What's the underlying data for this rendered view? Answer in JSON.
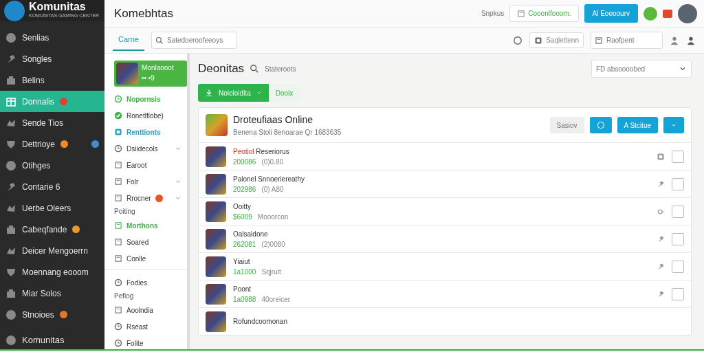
{
  "brand": {
    "name": "Komunitas",
    "tagline": "KOMUNITAS GAMING CENTER"
  },
  "sidebar": {
    "items": [
      {
        "label": "Senlias",
        "selected": false
      },
      {
        "label": "Songles",
        "selected": false
      },
      {
        "label": "Belins",
        "selected": false
      },
      {
        "label": "Donnalis",
        "selected": true,
        "color": "#e0412f"
      },
      {
        "label": "Sende Tios",
        "selected": false
      },
      {
        "label": "Dettrioye",
        "selected": false,
        "color": "#f08a24"
      },
      {
        "label": "Otihges",
        "selected": false
      },
      {
        "label": "Contarie 6",
        "selected": false
      },
      {
        "label": "Uerbe Oleers",
        "selected": false
      },
      {
        "label": "Cabeqfande",
        "selected": false,
        "color": "#f0962a"
      },
      {
        "label": "Deicer Mengoerrn",
        "selected": false
      },
      {
        "label": "Moennang eooom",
        "selected": false
      },
      {
        "label": "Miar Solos",
        "selected": false
      },
      {
        "label": "Stnoioes",
        "selected": false,
        "color": "#e8732a"
      }
    ],
    "footer": "Komunitas"
  },
  "header": {
    "title": "Komebhtas",
    "link": "Snpkus",
    "outline_button": "Cooonlfooom.",
    "primary_button": "Al Eoooourv"
  },
  "subbar": {
    "tab": "Carne",
    "search_placeholder": "Satedoeroofeeoys",
    "button": "Saqlettenn",
    "field_placeholder": "Raofpent"
  },
  "panel": {
    "featured": {
      "title": "Monlaooot",
      "meta": "•• •9"
    },
    "items": [
      {
        "kind": "item",
        "label": "Nopornsis",
        "color": "#3cb043"
      },
      {
        "kind": "item",
        "label": "Ronetlfiobe)"
      },
      {
        "kind": "item",
        "label": "Renttionts",
        "color": "#1ea0c8"
      },
      {
        "kind": "item",
        "label": "Dsiidecols",
        "expanded": false
      },
      {
        "kind": "item",
        "label": "Earoot"
      },
      {
        "kind": "item",
        "label": "Folr",
        "expanded": false
      },
      {
        "kind": "item",
        "label": "Rrocner",
        "expanded": false,
        "alert": true
      },
      {
        "kind": "header",
        "label": "Poiting"
      },
      {
        "kind": "item",
        "label": "Morthons",
        "color": "#3cb043"
      },
      {
        "kind": "item",
        "label": "Soared"
      },
      {
        "kind": "item",
        "label": "Conlle"
      },
      {
        "kind": "divider"
      },
      {
        "kind": "item",
        "label": "Fodies"
      },
      {
        "kind": "header",
        "label": "Pefiog"
      },
      {
        "kind": "item",
        "label": "Aoolndia"
      },
      {
        "kind": "item",
        "label": "Rseast"
      },
      {
        "kind": "item",
        "label": "Folite"
      }
    ]
  },
  "main": {
    "title": "Deonitas",
    "subtitle": "Stateroots",
    "select": "FD absoooobed",
    "primary_button": "Noioloidita",
    "secondary_button": "Dooix",
    "card": {
      "title": "Droteufiaas Online",
      "subtitle": "Benena Stoli 8enoarae Qr 1683635",
      "filter_button": "Sasiov",
      "action_button": "A Stcitue"
    },
    "rows": [
      {
        "tag": "Peotiol",
        "title": "Reseriorus",
        "score": "200086",
        "meta": "(0)0.80",
        "checked": false
      },
      {
        "title": "Paionel Snnoeriereathy",
        "score": "202986",
        "meta": "(0) A80",
        "checked": false
      },
      {
        "title": "Ooitty",
        "score": "$6009",
        "meta": "Mooorcon",
        "checked": false
      },
      {
        "title": "Oalsaidone",
        "score": "262081",
        "meta": "(2)0080",
        "checked": false
      },
      {
        "title": "Yiaiut",
        "score": "1a1000",
        "meta": "Sqjruit",
        "checked": false
      },
      {
        "title": "Poont",
        "score": "1a0988",
        "meta": "40oreicer",
        "checked": false
      },
      {
        "title": "Rofundcoomonan"
      }
    ]
  }
}
